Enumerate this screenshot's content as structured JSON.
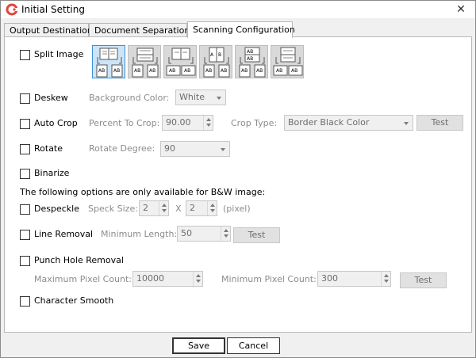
{
  "window": {
    "title": "Initial Setting",
    "close_glyph": "✕",
    "icon": "app-logo-icon"
  },
  "tabs": [
    {
      "label": "Output Destination",
      "active": false
    },
    {
      "label": "Document Separation",
      "active": false
    },
    {
      "label": "Scanning Configuration",
      "active": true
    }
  ],
  "split_image": {
    "label": "Split Image",
    "checked": false,
    "layout_options": [
      {
        "icon": "split-layout-1-icon",
        "selected": true
      },
      {
        "icon": "split-layout-2-icon",
        "selected": false
      },
      {
        "icon": "split-layout-3-icon",
        "selected": false
      },
      {
        "icon": "split-layout-4-icon",
        "selected": false
      },
      {
        "icon": "split-layout-5-icon",
        "selected": false
      },
      {
        "icon": "split-layout-6-icon",
        "selected": false
      }
    ]
  },
  "deskew": {
    "label": "Deskew",
    "checked": false,
    "background_color_label": "Background Color:",
    "background_color_value": "White"
  },
  "auto_crop": {
    "label": "Auto Crop",
    "checked": false,
    "percent_label": "Percent To Crop:",
    "percent_value": "90.00",
    "crop_type_label": "Crop Type:",
    "crop_type_value": "Border Black Color",
    "test_label": "Test"
  },
  "rotate": {
    "label": "Rotate",
    "checked": false,
    "degree_label": "Rotate Degree:",
    "degree_value": "90"
  },
  "binarize": {
    "label": "Binarize",
    "checked": false
  },
  "bw_note": "The following options are only available for B&W image:",
  "despeckle": {
    "label": "Despeckle",
    "checked": false,
    "speck_size_label": "Speck Size:",
    "width_value": "2",
    "x_label": "X",
    "height_value": "2",
    "unit_label": "(pixel)"
  },
  "line_removal": {
    "label": "Line Removal",
    "checked": false,
    "min_length_label": "Minimum Length:",
    "min_length_value": "50",
    "test_label": "Test"
  },
  "punch_hole": {
    "label": "Punch Hole Removal",
    "checked": false,
    "max_label": "Maximum Pixel Count:",
    "max_value": "10000",
    "min_label": "Minimum Pixel Count:",
    "min_value": "300",
    "test_label": "Test"
  },
  "char_smooth": {
    "label": "Character Smooth",
    "checked": false
  },
  "footer": {
    "save_label": "Save",
    "cancel_label": "Cancel"
  },
  "colors": {
    "selected_bg": "#cce4f7",
    "selected_border": "#3c8fd6",
    "disabled_text": "#8c8c8c",
    "app_icon_red": "#e0463c"
  }
}
